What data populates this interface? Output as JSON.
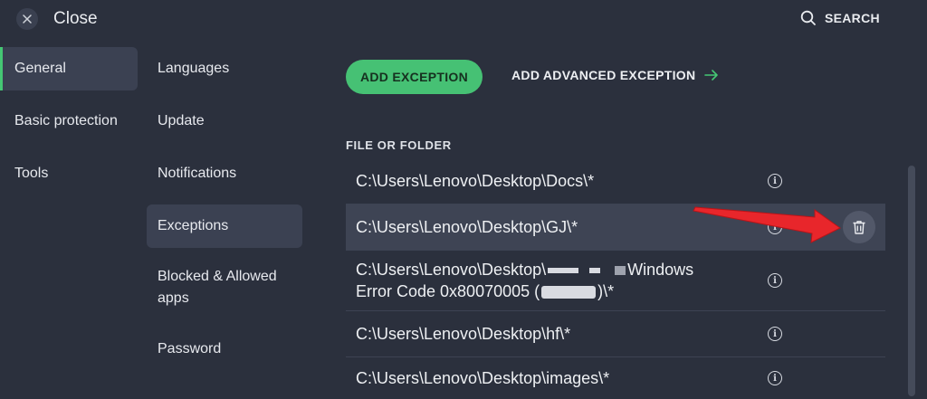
{
  "topbar": {
    "close_label": "Close",
    "search_label": "SEARCH"
  },
  "primary_nav": [
    {
      "label": "General",
      "active": true
    },
    {
      "label": "Basic protection",
      "active": false
    },
    {
      "label": "Tools",
      "active": false
    }
  ],
  "secondary_nav": [
    {
      "label": "Languages",
      "active": false
    },
    {
      "label": "Update",
      "active": false
    },
    {
      "label": "Notifications",
      "active": false
    },
    {
      "label": "Exceptions",
      "active": true
    },
    {
      "label": "Blocked & Allowed apps",
      "active": false
    },
    {
      "label": "Password",
      "active": false
    }
  ],
  "main": {
    "add_exception_label": "ADD EXCEPTION",
    "add_advanced_label": "ADD ADVANCED EXCEPTION",
    "section_title": "FILE OR FOLDER",
    "rows": [
      {
        "path": "C:\\Users\\Lenovo\\Desktop\\Docs\\*"
      },
      {
        "path": "C:\\Users\\Lenovo\\Desktop\\GJ\\*",
        "highlighted": true
      },
      {
        "path_line1_start": "C:\\Users\\Lenovo\\Desktop\\",
        "path_line1_end": "Windows",
        "path_line2_start": "Error Code 0x80070005 (",
        "path_line2_end": ")\\*"
      },
      {
        "path": "C:\\Users\\Lenovo\\Desktop\\hf\\*"
      },
      {
        "path": "C:\\Users\\Lenovo\\Desktop\\images\\*"
      }
    ]
  },
  "colors": {
    "background": "#2b303d",
    "accent_green": "#46c174",
    "active_item": "#3b4152",
    "annotation_arrow": "#e8262b"
  },
  "icons": [
    "close-icon",
    "search-icon",
    "arrow-right-icon",
    "info-icon",
    "trash-icon"
  ]
}
